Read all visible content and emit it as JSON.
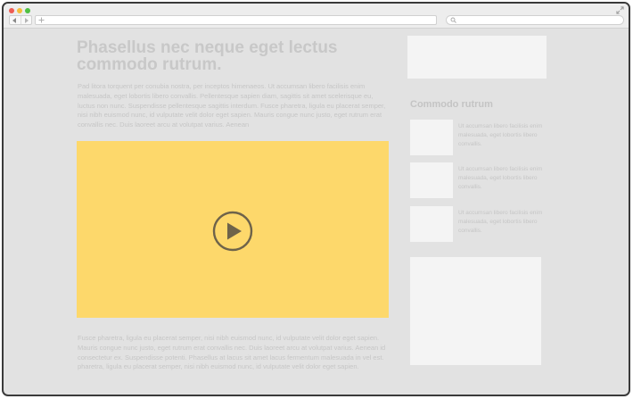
{
  "browser": {
    "controls": {
      "close": "close",
      "minimize": "minimize",
      "maximize": "maximize"
    },
    "icons": [
      "back-icon",
      "forward-icon",
      "plus-icon",
      "search-icon",
      "expand-icon"
    ]
  },
  "article": {
    "title": "Phasellus nec neque eget lectus commodo rutrum.",
    "intro": "Pad litora torquent per conubia nostra, per inceptos himenaeos. Ut accumsan libero facilisis enim malesuada, eget lobortis libero convallis. Pellentesque sapien diam, sagittis sit amet scelerisque eu, luctus non nunc. Suspendisse pellentesque sagittis interdum. Fusce pharetra, ligula eu placerat semper, nisi nibh euismod nunc, id vulputate velit dolor eget sapien. Mauris congue nunc justo, eget rutrum erat convallis nec. Duis laoreet arcu at volutpat varius. Aenean",
    "video": {
      "accent_color": "#fdd86b",
      "icon": "play-icon"
    },
    "body": "Fusce pharetra, ligula eu placerat semper, nisi nibh euismod nunc, id vulputate velit dolor eget sapien. Mauris congue nunc justo, eget rutrum erat convallis nec. Duis laoreet arcu at volutpat varius. Aenean id consectetur ex. Suspendisse potenti. Phasellus at lacus sit amet lacus fermentum malesuada in vel est. pharetra, ligula eu placerat semper, nisi nibh euismod nunc, id vulputate velit dolor eget sapien."
  },
  "sidebar": {
    "heading": "Commodo rutrum",
    "items": [
      {
        "text": "Ut accumsan libero facilisis enim malesuada, eget lobortis libero convallis."
      },
      {
        "text": "Ut accumsan libero facilisis enim malesuada, eget lobortis libero convallis."
      },
      {
        "text": "Ut accumsan libero facilisis enim malesuada, eget lobortis libero convallis."
      }
    ]
  }
}
